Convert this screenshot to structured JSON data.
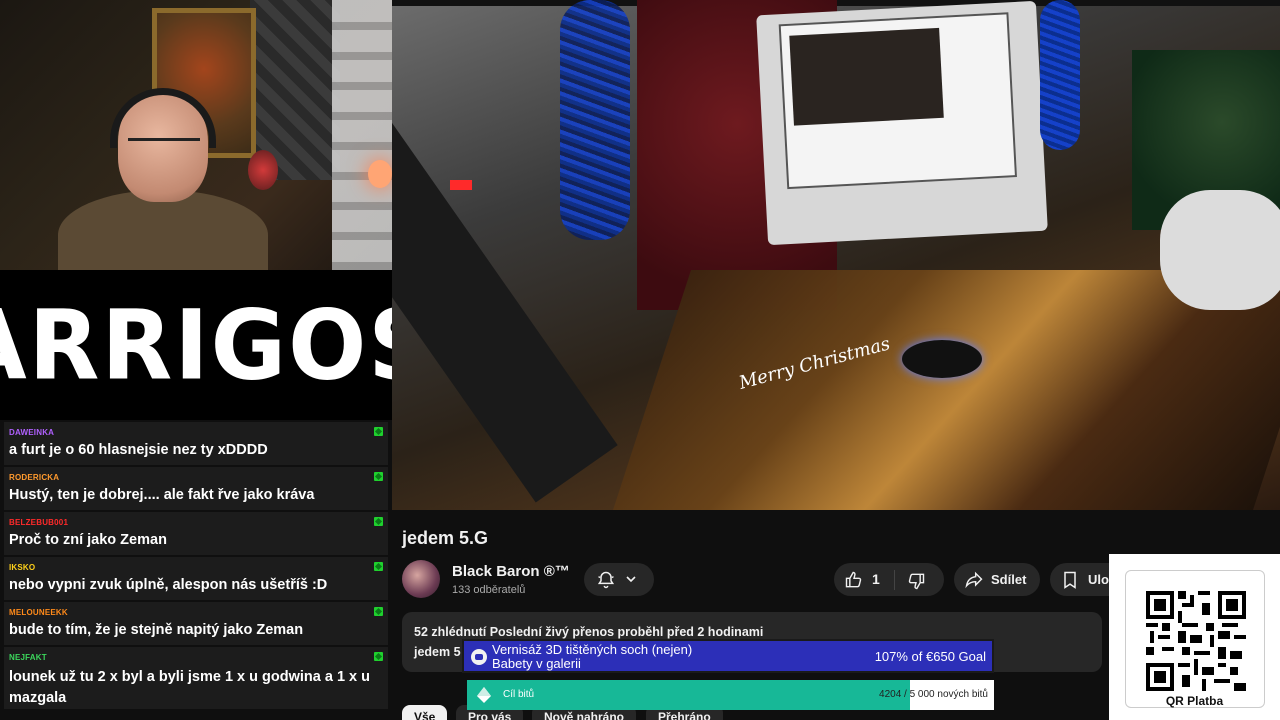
{
  "logo": {
    "text": "ARRIGOS"
  },
  "chat": {
    "messages": [
      {
        "user": "DAWEINKA",
        "user_color": "#b060ff",
        "text": "a furt je o 60 hlasnejsie nez ty xDDDD"
      },
      {
        "user": "RODERICKA",
        "user_color": "#ff9a2e",
        "text": "Hustý, ten je dobrej.... ale fakt řve jako kráva"
      },
      {
        "user": "BELZEBUB001",
        "user_color": "#ff2a2a",
        "text": "Proč to zní jako Zeman"
      },
      {
        "user": "IKSKO",
        "user_color": "#ffd11a",
        "text": "nebo vypni zvuk úplně, alespon nás ušetříš :D"
      },
      {
        "user": "MELOUNEEKK",
        "user_color": "#ff8a1a",
        "text": "bude to tím, že je stejně napitý jako Zeman"
      },
      {
        "user": "NEJFAKT",
        "user_color": "#3cd65c",
        "text": "lounek už tu 2 x byl a byli jsme 1 x u godwina a 1 x u mazgala"
      }
    ]
  },
  "video": {
    "overlay_text": "Merry Christmas",
    "title": "jedem 5.G",
    "channel": {
      "name": "Black Baron ®™",
      "subscribers": "133 odběratelů"
    },
    "likes": "1",
    "share_label": "Sdílet",
    "save_label": "Ulož",
    "description": {
      "meta": "52 zhlédnutí  Poslední živý přenos proběhl před 2 hodinami",
      "line": "jedem 5"
    },
    "chips": [
      "Vše",
      "Pro vás",
      "Nově nahráno",
      "Přehráno"
    ]
  },
  "goal": {
    "title_line1": "Vernisáž 3D tištěných soch (nejen)",
    "title_line2": "Babety v galerii",
    "progress_text": "107% of €650 Goal",
    "color": "#2c2fb8"
  },
  "bits": {
    "label": "Cíl bitů",
    "count_text": "4204 / 5 000 nových bitů",
    "progress": 0.8408,
    "color": "#17b897"
  },
  "qr": {
    "label": "QR Platba"
  },
  "icons": [
    "bell-icon",
    "chevron-down-icon",
    "thumbs-up-icon",
    "thumbs-down-icon",
    "share-icon",
    "save-icon",
    "diamond-icon",
    "qr-icon",
    "mod-badge-icon"
  ]
}
